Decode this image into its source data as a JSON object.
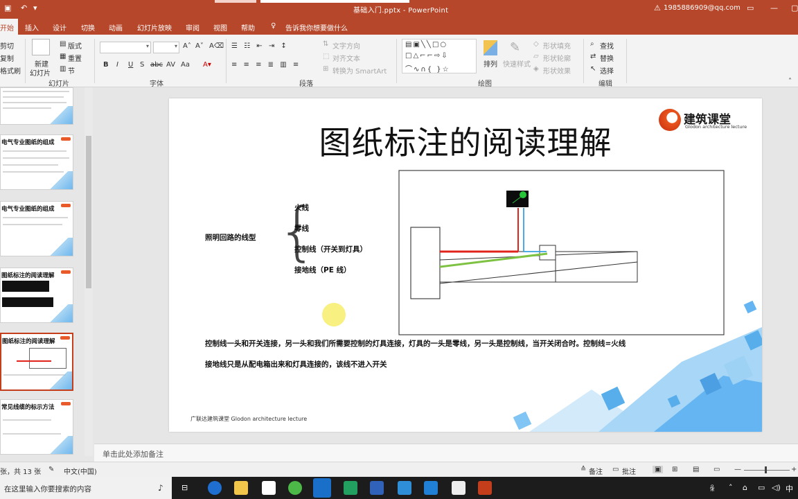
{
  "titlebar": {
    "document": "基础入门.pptx - PowerPoint",
    "account": "1985886909@qq.com"
  },
  "tabs": [
    {
      "label": "开始",
      "active": true
    },
    {
      "label": "插入"
    },
    {
      "label": "设计"
    },
    {
      "label": "切换"
    },
    {
      "label": "动画"
    },
    {
      "label": "幻灯片放映"
    },
    {
      "label": "审阅"
    },
    {
      "label": "视图"
    },
    {
      "label": "帮助"
    },
    {
      "label": "告诉我你想要做什么"
    }
  ],
  "ribbon": {
    "clipboard": {
      "cut": "剪切",
      "copy": "复制",
      "format": "格式刷"
    },
    "slides": {
      "new_slide_1": "新建",
      "new_slide_2": "幻灯片",
      "layout": "版式",
      "reset": "重置",
      "section": "节",
      "group": "幻灯片"
    },
    "font": {
      "group": "字体",
      "bold": "B",
      "italic": "I",
      "underline": "U",
      "shadow": "S",
      "strike": "abc",
      "spacing": "AV",
      "case": "Aa"
    },
    "paragraph": {
      "group": "段落",
      "text_direction": "文字方向",
      "align_text": "对齐文本",
      "smartart": "转换为 SmartArt"
    },
    "drawing": {
      "group": "绘图",
      "arrange": "排列",
      "quick_styles": "快速样式",
      "fill": "形状填充",
      "outline": "形状轮廓",
      "effects": "形状效果"
    },
    "editing": {
      "group": "编辑",
      "find": "查找",
      "replace": "替换",
      "select": "选择"
    }
  },
  "thumbnails": [
    {
      "title": ""
    },
    {
      "title": "电气专业图纸的组成"
    },
    {
      "title": "电气专业图纸的组成"
    },
    {
      "title": "图纸标注的阅读理解"
    },
    {
      "title": "图纸标注的阅读理解",
      "selected": true
    },
    {
      "title": "常见线缆的标示方法"
    }
  ],
  "slide": {
    "title": "图纸标注的阅读理解",
    "logo_name": "建筑课堂",
    "logo_sub": "Glodon architecture lecture",
    "circuit_label": "照明回路的线型",
    "lines": [
      "火线",
      "零线",
      "控制线（开关到灯具）",
      "接地线（PE 线）"
    ],
    "note1": "控制线一头和开关连接，另一头和我们所需要控制的灯具连接，灯具的一头是零线，另一头是控制线，当开关闭合时。控制线=火线",
    "note2": "接地线只是从配电箱出来和灯具连接的，该线不进入开关",
    "footer": "广联达建筑课堂   Glodon  architecture  lecture",
    "colors": {
      "live": "#e0241b",
      "neutral": "#3aa0e0",
      "earth": "#7dc242",
      "lamp_dot": "#27c43a"
    }
  },
  "notes_placeholder": "单击此处添加备注",
  "status": {
    "slide_count": "张，共 13 张",
    "language": "中文(中国)",
    "notes": "备注",
    "comments": "批注"
  },
  "taskbar": {
    "search_placeholder": "在这里输入你要搜索的内容",
    "ime": "中"
  }
}
